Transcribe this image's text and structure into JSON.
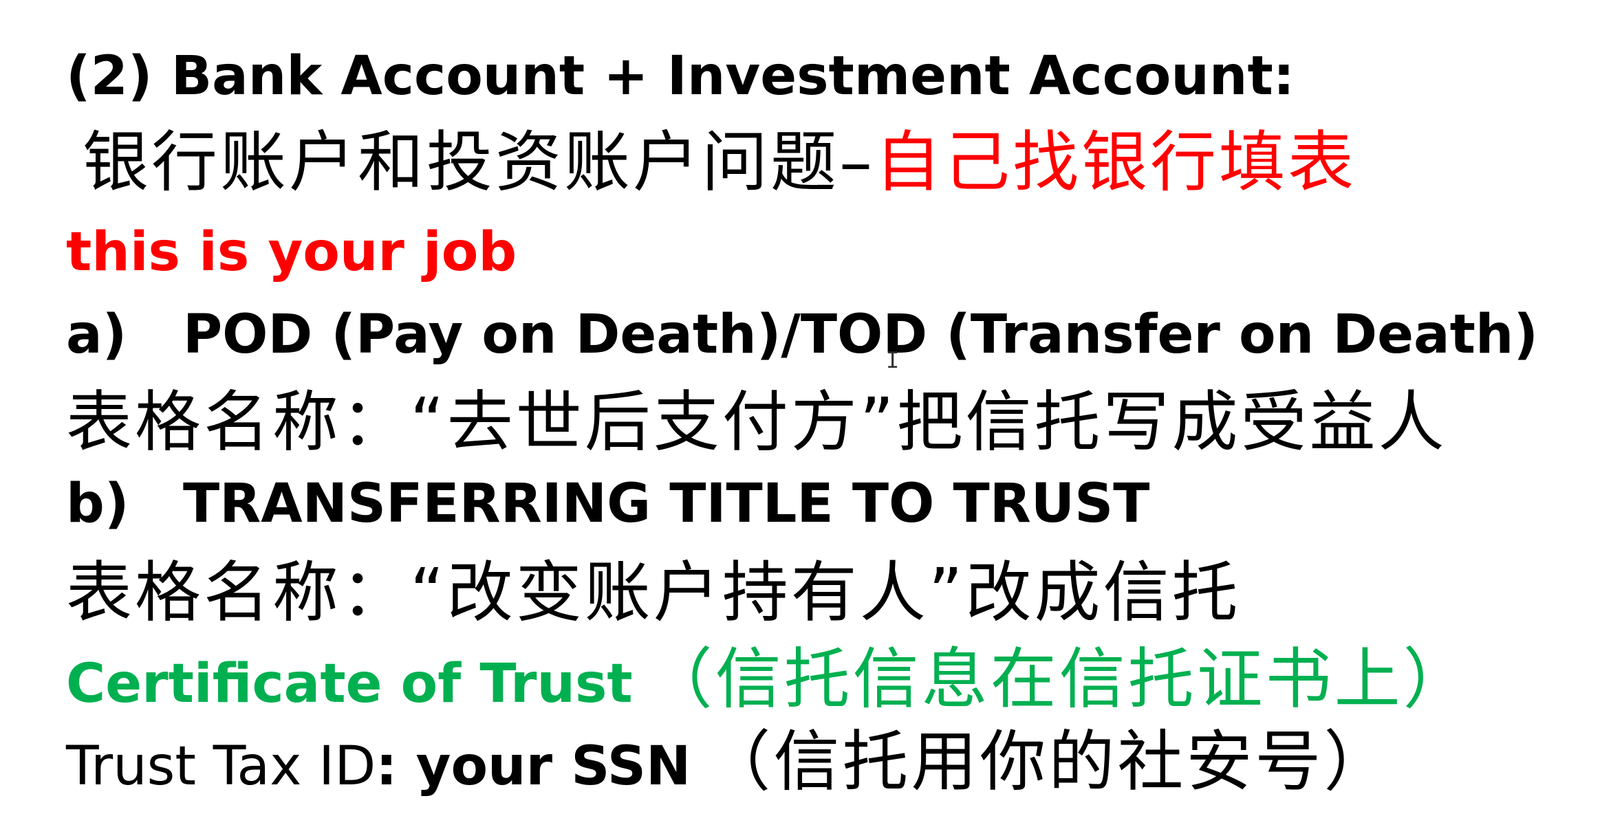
{
  "slide": {
    "heading": "(2) Bank Account + Investment Account:",
    "cn_subtitle_black": "银行账户和投资账户问题",
    "cn_subtitle_dash": "–",
    "cn_subtitle_red": "自己找银行填表",
    "note_red": "this is your job",
    "item_a": {
      "marker": "a)",
      "text": "POD (Pay on Death)/TOD (Transfer on Death)",
      "cn_form": "表格名称：“去世后支付方”把信托写成受益人"
    },
    "item_b": {
      "marker": "b)",
      "text": "TRANSFERRING TITLE TO TRUST",
      "cn_form": "表格名称：“改变账户持有人”改成信托"
    },
    "certificate": {
      "label": "Certificate of Trust",
      "cn": "（信托信息在信托证书上）"
    },
    "tax_id": {
      "prefix": "Trust Tax ID",
      "colon": ":",
      "value": " your SSN",
      "cn": "（信托用你的社安号）"
    }
  },
  "colors": {
    "text": "#000000",
    "red": "#ff0000",
    "green": "#00b050",
    "background": "#ffffff"
  }
}
